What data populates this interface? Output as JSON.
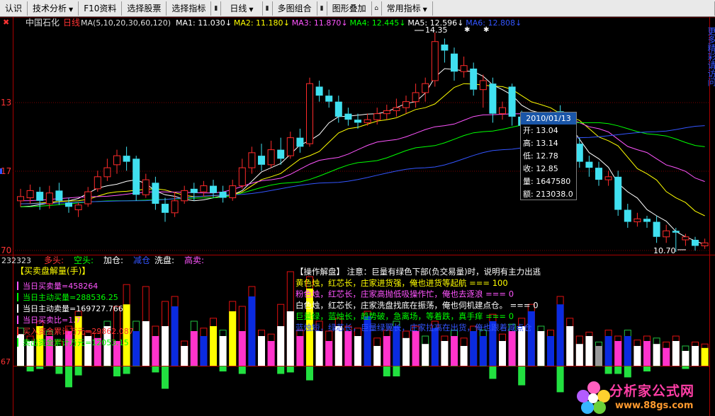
{
  "toolbar": {
    "items": [
      "认识",
      "技术分析",
      "F10资料",
      "选择股票",
      "选择指标",
      "日线",
      "多图组合",
      "图形叠加",
      "常用指标"
    ]
  },
  "main_panel": {
    "title": "中国石化",
    "period": "日线",
    "ma_label": "MA(5,10,20,30,60,120)",
    "ma_values": [
      {
        "label": "MA1: 11.030",
        "color": "#ffffff"
      },
      {
        "label": "MA2: 11.180",
        "color": "#ffff00"
      },
      {
        "label": "MA3: 11.870",
        "color": "#ff55ff"
      },
      {
        "label": "MA4: 12.445",
        "color": "#00ff00"
      },
      {
        "label": "MA5: 12.596",
        "color": "#ffffff"
      },
      {
        "label": "MA6: 12.808",
        "color": "#3355ff"
      }
    ],
    "left_axis": [
      "13",
      "17",
      "70"
    ],
    "high_price_label": "14.35",
    "low_price_label": "10.70"
  },
  "candles": [
    {
      "o": 11.55,
      "c": 11.62,
      "h": 11.75,
      "l": 11.45
    },
    {
      "o": 11.6,
      "c": 11.72,
      "h": 11.82,
      "l": 11.5
    },
    {
      "o": 11.7,
      "c": 11.55,
      "h": 11.78,
      "l": 11.4
    },
    {
      "o": 11.5,
      "c": 11.68,
      "h": 11.8,
      "l": 11.42
    },
    {
      "o": 11.72,
      "c": 11.55,
      "h": 11.85,
      "l": 11.48
    },
    {
      "o": 11.52,
      "c": 11.45,
      "h": 11.6,
      "l": 11.35
    },
    {
      "o": 11.4,
      "c": 11.48,
      "h": 11.52,
      "l": 11.28
    },
    {
      "o": 11.5,
      "c": 11.7,
      "h": 11.78,
      "l": 11.45
    },
    {
      "o": 11.75,
      "c": 11.95,
      "h": 12.05,
      "l": 11.7
    },
    {
      "o": 11.95,
      "c": 12.1,
      "h": 12.25,
      "l": 11.88
    },
    {
      "o": 12.15,
      "c": 12.3,
      "h": 12.4,
      "l": 12.0
    },
    {
      "o": 12.3,
      "c": 12.2,
      "h": 12.45,
      "l": 12.05
    },
    {
      "o": 12.25,
      "c": 11.65,
      "h": 12.3,
      "l": 11.55
    },
    {
      "o": 11.65,
      "c": 11.9,
      "h": 12.0,
      "l": 11.6
    },
    {
      "o": 11.85,
      "c": 11.5,
      "h": 11.95,
      "l": 11.4
    },
    {
      "o": 11.5,
      "c": 11.35,
      "h": 11.6,
      "l": 11.2
    },
    {
      "o": 11.35,
      "c": 11.55,
      "h": 11.7,
      "l": 11.28
    },
    {
      "o": 11.55,
      "c": 11.72,
      "h": 11.8,
      "l": 11.5
    },
    {
      "o": 11.75,
      "c": 11.68,
      "h": 11.85,
      "l": 11.55
    },
    {
      "o": 11.7,
      "c": 11.8,
      "h": 11.88,
      "l": 11.62
    },
    {
      "o": 11.8,
      "c": 11.68,
      "h": 11.9,
      "l": 11.6
    },
    {
      "o": 11.7,
      "c": 11.6,
      "h": 11.8,
      "l": 11.52
    },
    {
      "o": 11.6,
      "c": 11.8,
      "h": 11.9,
      "l": 11.55
    },
    {
      "o": 11.8,
      "c": 12.1,
      "h": 12.25,
      "l": 11.75
    },
    {
      "o": 12.1,
      "c": 12.35,
      "h": 12.45,
      "l": 12.0
    },
    {
      "o": 12.3,
      "c": 12.15,
      "h": 12.5,
      "l": 12.05
    },
    {
      "o": 12.15,
      "c": 12.4,
      "h": 12.55,
      "l": 12.1
    },
    {
      "o": 12.4,
      "c": 12.25,
      "h": 12.6,
      "l": 12.15
    },
    {
      "o": 12.3,
      "c": 12.6,
      "h": 12.7,
      "l": 12.25
    },
    {
      "o": 12.6,
      "c": 12.45,
      "h": 12.75,
      "l": 12.35
    },
    {
      "o": 12.5,
      "c": 13.5,
      "h": 13.6,
      "l": 12.45
    },
    {
      "o": 13.45,
      "c": 13.3,
      "h": 13.55,
      "l": 13.2
    },
    {
      "o": 13.3,
      "c": 13.2,
      "h": 13.4,
      "l": 13.1
    },
    {
      "o": 13.2,
      "c": 12.95,
      "h": 13.3,
      "l": 12.85
    },
    {
      "o": 13.0,
      "c": 12.9,
      "h": 13.1,
      "l": 12.8
    },
    {
      "o": 12.9,
      "c": 12.85,
      "h": 13.0,
      "l": 12.75
    },
    {
      "o": 12.85,
      "c": 12.9,
      "h": 13.0,
      "l": 12.8
    },
    {
      "o": 12.9,
      "c": 13.0,
      "h": 13.1,
      "l": 12.82
    },
    {
      "o": 13.0,
      "c": 13.05,
      "h": 13.15,
      "l": 12.9
    },
    {
      "o": 13.05,
      "c": 13.1,
      "h": 13.25,
      "l": 12.95
    },
    {
      "o": 13.1,
      "c": 13.2,
      "h": 13.3,
      "l": 13.0
    },
    {
      "o": 13.2,
      "c": 13.35,
      "h": 13.5,
      "l": 13.1
    },
    {
      "o": 13.35,
      "c": 13.5,
      "h": 13.6,
      "l": 13.2
    },
    {
      "o": 13.55,
      "c": 14.2,
      "h": 14.35,
      "l": 13.45
    },
    {
      "o": 14.15,
      "c": 14.05,
      "h": 14.25,
      "l": 13.85
    },
    {
      "o": 14.0,
      "c": 13.7,
      "h": 14.1,
      "l": 13.55
    },
    {
      "o": 13.7,
      "c": 13.8,
      "h": 13.95,
      "l": 13.6
    },
    {
      "o": 13.75,
      "c": 13.4,
      "h": 13.85,
      "l": 13.3
    },
    {
      "o": 13.4,
      "c": 13.55,
      "h": 13.65,
      "l": 13.1
    },
    {
      "o": 13.5,
      "c": 13.0,
      "h": 13.6,
      "l": 12.85
    },
    {
      "o": 13.0,
      "c": 13.1,
      "h": 13.2,
      "l": 12.9
    },
    {
      "o": 13.45,
      "c": 12.95,
      "h": 13.5,
      "l": 12.8
    },
    {
      "o": 12.95,
      "c": 12.8,
      "h": 13.05,
      "l": 12.7
    },
    {
      "o": 12.8,
      "c": 12.9,
      "h": 13.0,
      "l": 12.7
    },
    {
      "o": 12.9,
      "c": 12.85,
      "h": 13.0,
      "l": 12.75
    },
    {
      "o": 12.9,
      "c": 12.95,
      "h": 13.05,
      "l": 12.8
    },
    {
      "o": 13.04,
      "c": 12.85,
      "h": 13.14,
      "l": 12.78
    },
    {
      "o": 12.85,
      "c": 12.5,
      "h": 12.95,
      "l": 12.4
    },
    {
      "o": 12.5,
      "c": 12.2,
      "h": 12.6,
      "l": 12.1
    },
    {
      "o": 12.2,
      "c": 12.1,
      "h": 12.3,
      "l": 11.95
    },
    {
      "o": 12.1,
      "c": 11.9,
      "h": 12.2,
      "l": 11.8
    },
    {
      "o": 11.9,
      "c": 11.95,
      "h": 12.05,
      "l": 11.8
    },
    {
      "o": 11.95,
      "c": 11.4,
      "h": 12.05,
      "l": 11.3
    },
    {
      "o": 11.4,
      "c": 11.2,
      "h": 11.5,
      "l": 11.1
    },
    {
      "o": 11.2,
      "c": 11.25,
      "h": 11.35,
      "l": 11.12
    },
    {
      "o": 11.25,
      "c": 11.2,
      "h": 11.3,
      "l": 11.1
    },
    {
      "o": 11.2,
      "c": 10.95,
      "h": 11.3,
      "l": 10.85
    },
    {
      "o": 10.95,
      "c": 11.05,
      "h": 11.15,
      "l": 10.85
    },
    {
      "o": 11.05,
      "c": 11.02,
      "h": 11.1,
      "l": 10.7
    },
    {
      "o": 10.9,
      "c": 10.95,
      "h": 11.0,
      "l": 10.8
    },
    {
      "o": 10.9,
      "c": 10.8,
      "h": 10.95,
      "l": 10.72
    },
    {
      "o": 10.8,
      "c": 10.85,
      "h": 10.92,
      "l": 10.75
    }
  ],
  "ma_lines": [
    {
      "color": "#ffffff",
      "anchors": [
        [
          0,
          11.45
        ],
        [
          5,
          11.55
        ],
        [
          9,
          11.8
        ],
        [
          12,
          11.9
        ],
        [
          15,
          11.65
        ],
        [
          18,
          11.55
        ],
        [
          22,
          11.65
        ],
        [
          26,
          12.1
        ],
        [
          30,
          12.55
        ],
        [
          33,
          12.95
        ],
        [
          37,
          13.0
        ],
        [
          41,
          13.2
        ],
        [
          44,
          13.75
        ],
        [
          47,
          13.7
        ],
        [
          50,
          13.4
        ],
        [
          53,
          13.05
        ],
        [
          56,
          12.9
        ],
        [
          60,
          12.25
        ],
        [
          63,
          11.7
        ],
        [
          66,
          11.3
        ],
        [
          69,
          10.95
        ],
        [
          71,
          10.82
        ]
      ]
    },
    {
      "color": "#ffff00",
      "anchors": [
        [
          0,
          11.5
        ],
        [
          6,
          11.55
        ],
        [
          10,
          11.7
        ],
        [
          14,
          11.75
        ],
        [
          18,
          11.62
        ],
        [
          22,
          11.65
        ],
        [
          26,
          11.95
        ],
        [
          30,
          12.3
        ],
        [
          34,
          12.75
        ],
        [
          38,
          12.9
        ],
        [
          42,
          13.1
        ],
        [
          46,
          13.5
        ],
        [
          50,
          13.45
        ],
        [
          54,
          13.15
        ],
        [
          57,
          12.95
        ],
        [
          61,
          12.55
        ],
        [
          65,
          12.0
        ],
        [
          68,
          11.6
        ],
        [
          71,
          11.3
        ]
      ]
    },
    {
      "color": "#ff55ff",
      "anchors": [
        [
          0,
          11.55
        ],
        [
          8,
          11.62
        ],
        [
          14,
          11.7
        ],
        [
          20,
          11.68
        ],
        [
          26,
          11.9
        ],
        [
          32,
          12.25
        ],
        [
          38,
          12.55
        ],
        [
          44,
          12.8
        ],
        [
          48,
          12.98
        ],
        [
          52,
          13.0
        ],
        [
          56,
          12.95
        ],
        [
          60,
          12.75
        ],
        [
          64,
          12.4
        ],
        [
          68,
          12.1
        ],
        [
          71,
          11.87
        ]
      ]
    },
    {
      "color": "#00ff00",
      "anchors": [
        [
          0,
          11.45
        ],
        [
          10,
          11.55
        ],
        [
          20,
          11.6
        ],
        [
          28,
          11.85
        ],
        [
          36,
          12.2
        ],
        [
          42,
          12.45
        ],
        [
          48,
          12.7
        ],
        [
          54,
          12.85
        ],
        [
          60,
          12.85
        ],
        [
          66,
          12.65
        ],
        [
          71,
          12.45
        ]
      ]
    },
    {
      "color": "#3355ff",
      "anchors": [
        [
          0,
          11.5
        ],
        [
          12,
          11.55
        ],
        [
          22,
          11.65
        ],
        [
          32,
          11.85
        ],
        [
          42,
          12.1
        ],
        [
          50,
          12.4
        ],
        [
          58,
          12.6
        ],
        [
          66,
          12.7
        ],
        [
          71,
          12.8
        ]
      ]
    }
  ],
  "tooltip": {
    "date": "2010/01/13",
    "rows": [
      "开: 13.04",
      "高: 13.14",
      "低: 12.78",
      "收: 12.85",
      "量: 1647580",
      "额: 213038.0"
    ]
  },
  "sub_panel": {
    "code": "232323",
    "labels": [
      {
        "text": "多头:",
        "color": "#ff3333"
      },
      {
        "text": "空头:",
        "color": "#00ff00"
      },
      {
        "text": "加仓:",
        "color": "#ffffff"
      },
      {
        "text": "减仓",
        "color": "#3355ff"
      },
      {
        "text": "洗盘:",
        "color": "#ffffff"
      },
      {
        "text": "高卖:",
        "color": "#ff55ff"
      }
    ],
    "panel_title": "【买卖盘解量(手)】",
    "left_axis": "67",
    "info_lines": [
      {
        "text": "当日买卖量=458264",
        "color": "#ff55ff"
      },
      {
        "text": "当日主动买量=288536.25",
        "color": "#00ff00"
      },
      {
        "text": "当日主动卖量=169727.766",
        "color": "#ffffff"
      },
      {
        "text": "当日买卖比=1.7",
        "color": "#ff55ff"
      },
      {
        "text": "买入资金累计万元=29862.087",
        "color": "#ff3333"
      },
      {
        "text": "卖出资金累计万元=12053.15",
        "color": "#00ff00"
      }
    ],
    "notes": [
      {
        "text": "【操作解盘】 注意：巨量有绿色下部(负交易量)时，说明有主力出逃",
        "color": "#ffffff"
      },
      {
        "text": "黄色烛，红芯长，庄家进货强，俺也进货等起航 === 100",
        "color": "#ffff00"
      },
      {
        "text": "粉色烛，红芯长，庄家高抛低吸操作忙，俺也去逐浪 === 0",
        "color": "#ff55ff"
      },
      {
        "text": "白色烛，红芯长，庄家洗盘找底在振荡，俺也伺机建点仓。 === 0",
        "color": "#ffffff"
      },
      {
        "text": "巨量绿，蓝烛长，趋势破，急离场，等着跌，真手痒 === 0",
        "color": "#00ff00"
      },
      {
        "text": "蓝烛短，绿芯长，巨量绿翼长，庄家拉高在出货，俺也跟着减点仓",
        "color": "#3355ff"
      }
    ]
  },
  "volume_bars": [
    {
      "u": 0.32,
      "d": 0.0,
      "c": "white",
      "r": 0.38
    },
    {
      "u": 0.25,
      "d": 0.1,
      "c": "white",
      "r": 0.3
    },
    {
      "u": 0.4,
      "d": 0.05,
      "c": "yellow",
      "r": 0.45
    },
    {
      "u": 0.3,
      "d": 0.0,
      "c": "magenta",
      "r": 0.35
    },
    {
      "u": 0.2,
      "d": 0.15,
      "c": "white",
      "r": 0.25
    },
    {
      "u": 0.35,
      "d": 0.42,
      "c": "magenta",
      "r": 0.4
    },
    {
      "u": 0.5,
      "d": 0.18,
      "c": "yellow",
      "r": 0.55
    },
    {
      "u": 0.3,
      "d": 0.0,
      "c": "white",
      "r": 0.35
    },
    {
      "u": 0.28,
      "d": 0.0,
      "c": "magenta",
      "r": 0.33
    },
    {
      "u": 0.4,
      "d": 0.0,
      "c": "white",
      "r": 0.45
    },
    {
      "u": 0.25,
      "d": 0.2,
      "c": "magenta",
      "r": 0.6
    },
    {
      "u": 0.62,
      "d": 0.15,
      "c": "yellow",
      "r": 0.82
    },
    {
      "u": 0.35,
      "d": 0.0,
      "c": "blue",
      "r": 0.45
    },
    {
      "u": 0.45,
      "d": 0.0,
      "c": "white",
      "r": 0.8
    },
    {
      "u": 0.3,
      "d": 0.12,
      "c": "magenta",
      "r": 0.4
    },
    {
      "u": 0.4,
      "d": 0.45,
      "c": "white",
      "r": 0.65
    },
    {
      "u": 0.6,
      "d": 0.0,
      "c": "blue",
      "r": 0.7
    },
    {
      "u": 0.2,
      "d": 0.0,
      "c": "white",
      "r": 0.25
    },
    {
      "u": 0.35,
      "d": 0.0,
      "c": "magenta",
      "r": 0.45
    },
    {
      "u": 0.3,
      "d": 0.0,
      "c": "blue",
      "r": 0.38
    },
    {
      "u": 0.4,
      "d": 0.0,
      "c": "yellow",
      "r": 0.48
    },
    {
      "u": 0.3,
      "d": 0.1,
      "c": "white",
      "r": 0.36
    },
    {
      "u": 0.55,
      "d": 0.0,
      "c": "yellow",
      "r": 0.65
    },
    {
      "u": 0.35,
      "d": 0.15,
      "c": "magenta",
      "r": 0.6
    },
    {
      "u": 0.7,
      "d": 0.0,
      "c": "blue",
      "r": 0.8
    },
    {
      "u": 0.3,
      "d": 0.0,
      "c": "white",
      "r": 0.36
    },
    {
      "u": 0.25,
      "d": 0.0,
      "c": "magenta",
      "r": 0.32
    },
    {
      "u": 0.4,
      "d": 0.15,
      "c": "white",
      "r": 0.62
    },
    {
      "u": 0.55,
      "d": 0.12,
      "c": "white",
      "r": 0.95
    },
    {
      "u": 0.3,
      "d": 0.0,
      "c": "magenta",
      "r": 0.36
    },
    {
      "u": 0.78,
      "d": 0.28,
      "c": "yellow",
      "r": 0.9
    },
    {
      "u": 0.35,
      "d": 0.0,
      "c": "white",
      "r": 0.45
    },
    {
      "u": 0.25,
      "d": 0.0,
      "c": "magenta",
      "r": 0.35
    },
    {
      "u": 0.4,
      "d": 0.0,
      "c": "white",
      "r": 0.48
    },
    {
      "u": 0.35,
      "d": 0.0,
      "c": "magenta",
      "r": 0.4
    },
    {
      "u": 0.3,
      "d": 0.0,
      "c": "white",
      "r": 0.38
    },
    {
      "u": 0.5,
      "d": 0.0,
      "c": "blue",
      "r": 0.55
    },
    {
      "u": 0.2,
      "d": 0.0,
      "c": "white",
      "r": 0.28
    },
    {
      "u": 0.3,
      "d": 0.2,
      "c": "magenta",
      "r": 0.36
    },
    {
      "u": 0.4,
      "d": 0.2,
      "c": "blue",
      "r": 0.45
    },
    {
      "u": 0.28,
      "d": 0.0,
      "c": "white",
      "r": 0.35
    },
    {
      "u": 0.35,
      "d": 0.0,
      "c": "magenta",
      "r": 0.4
    },
    {
      "u": 0.22,
      "d": 0.0,
      "c": "white",
      "r": 0.3
    },
    {
      "u": 0.38,
      "d": 0.0,
      "c": "blue",
      "r": 0.45
    },
    {
      "u": 0.25,
      "d": 0.0,
      "c": "white",
      "r": 0.3
    },
    {
      "u": 0.3,
      "d": 0.0,
      "c": "magenta",
      "r": 0.36
    },
    {
      "u": 0.2,
      "d": 0.0,
      "c": "white",
      "r": 0.28
    },
    {
      "u": 0.35,
      "d": 0.0,
      "c": "blue",
      "r": 0.4
    },
    {
      "u": 0.3,
      "d": 0.0,
      "c": "blue",
      "r": 0.36
    },
    {
      "u": 0.45,
      "d": 0.25,
      "c": "blue",
      "r": 0.52
    },
    {
      "u": 0.25,
      "d": 0.0,
      "c": "white",
      "r": 0.32
    },
    {
      "u": 0.35,
      "d": 0.0,
      "c": "magenta",
      "r": 0.42
    },
    {
      "u": 0.4,
      "d": 0.38,
      "c": "white",
      "r": 0.48
    },
    {
      "u": 0.55,
      "d": 0.0,
      "c": "blue",
      "r": 0.62
    },
    {
      "u": 0.35,
      "d": 0.0,
      "c": "white",
      "r": 0.4
    },
    {
      "u": 0.3,
      "d": 0.0,
      "c": "blue",
      "r": 0.36
    },
    {
      "u": 0.62,
      "d": 0.52,
      "c": "blue",
      "r": 0.7
    },
    {
      "u": 0.4,
      "d": 0.0,
      "c": "white",
      "r": 0.48
    },
    {
      "u": 0.22,
      "d": 0.0,
      "c": "white",
      "r": 0.3
    },
    {
      "u": 0.3,
      "d": 0.0,
      "c": "white",
      "r": 0.34
    },
    {
      "u": 0.2,
      "d": 0.0,
      "c": "gray",
      "r": 0.24
    },
    {
      "u": 0.3,
      "d": 0.15,
      "c": "blue",
      "r": 0.36
    },
    {
      "u": 0.25,
      "d": 0.15,
      "c": "magenta",
      "r": 0.3
    },
    {
      "u": 0.3,
      "d": 0.22,
      "c": "blue",
      "r": 0.36
    },
    {
      "u": 0.2,
      "d": 0.0,
      "c": "white",
      "r": 0.26
    },
    {
      "u": 0.25,
      "d": 0.1,
      "c": "magenta",
      "r": 0.3
    },
    {
      "u": 0.22,
      "d": 0.0,
      "c": "white",
      "r": 0.28
    },
    {
      "u": 0.18,
      "d": 0.0,
      "c": "magenta",
      "r": 0.24
    },
    {
      "u": 0.25,
      "d": 0.0,
      "c": "white",
      "r": 0.3
    },
    {
      "u": 0.15,
      "d": 0.05,
      "c": "white",
      "r": 0.2
    },
    {
      "u": 0.2,
      "d": 0.0,
      "c": "white",
      "r": 0.24
    },
    {
      "u": 0.18,
      "d": 0.0,
      "c": "yellow",
      "r": 0.22
    }
  ],
  "right_edge_text": "更多精彩请访问",
  "colors": {
    "up": "#ff2b2b",
    "down": "#40e0f0",
    "frame_red": "#aa0000",
    "grid_red": "#7a0000",
    "bar_white": "#ffffff",
    "bar_yellow": "#ffff00",
    "bar_magenta": "#ff33cc",
    "bar_blue": "#0a2be0",
    "bar_gray": "#999999",
    "bar_green": "#22e040",
    "bar_red_outline": "#e01010",
    "bar_green_outline": "#22c040"
  },
  "watermark": {
    "name": "分析家公式网",
    "url": "www.88gs.com"
  }
}
